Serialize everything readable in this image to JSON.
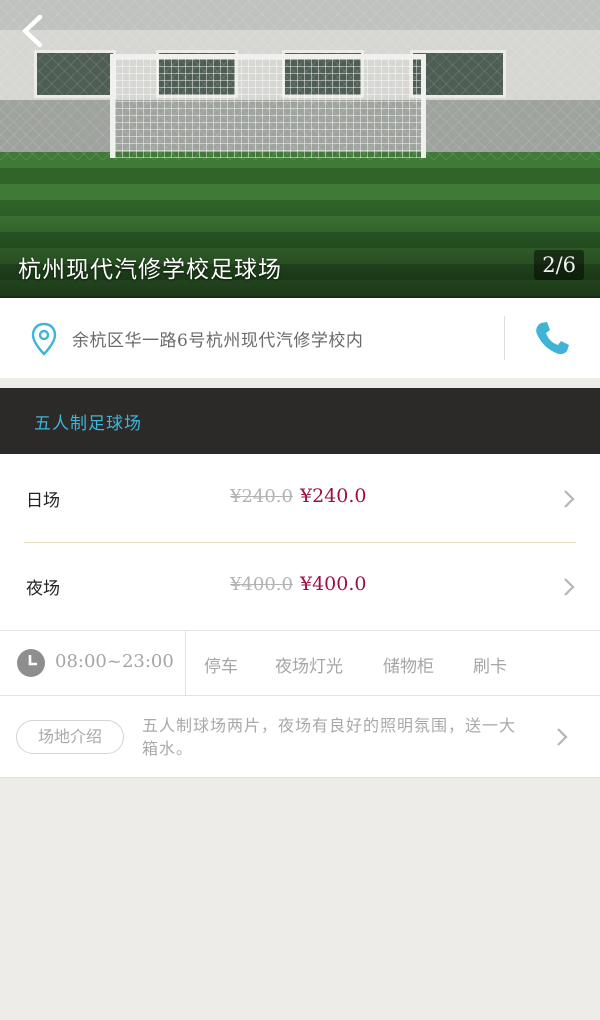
{
  "hero": {
    "title": "杭州现代汽修学校足球场",
    "counter": "2/6"
  },
  "address": {
    "text": "余杭区华一路6号杭州现代汽修学校内"
  },
  "category": {
    "label": "五人制足球场"
  },
  "prices": [
    {
      "name": "日场",
      "original": "¥240.0",
      "current": "¥240.0"
    },
    {
      "name": "夜场",
      "original": "¥400.0",
      "current": "¥400.0"
    }
  ],
  "facilities": {
    "hours": "08:00~23:00",
    "items": [
      "停车",
      "夜场灯光",
      "储物柜",
      "刷卡"
    ]
  },
  "intro": {
    "tag": "场地介绍",
    "text": "五人制球场两片，夜场有良好的照明氛围，送一大箱水。"
  },
  "colors": {
    "accent": "#3fb4d6",
    "price": "#9b1146",
    "category_bg": "#2b2a29"
  },
  "icons": [
    "back-arrow-icon",
    "location-pin-icon",
    "phone-icon",
    "clock-icon",
    "chevron-right-icon"
  ]
}
